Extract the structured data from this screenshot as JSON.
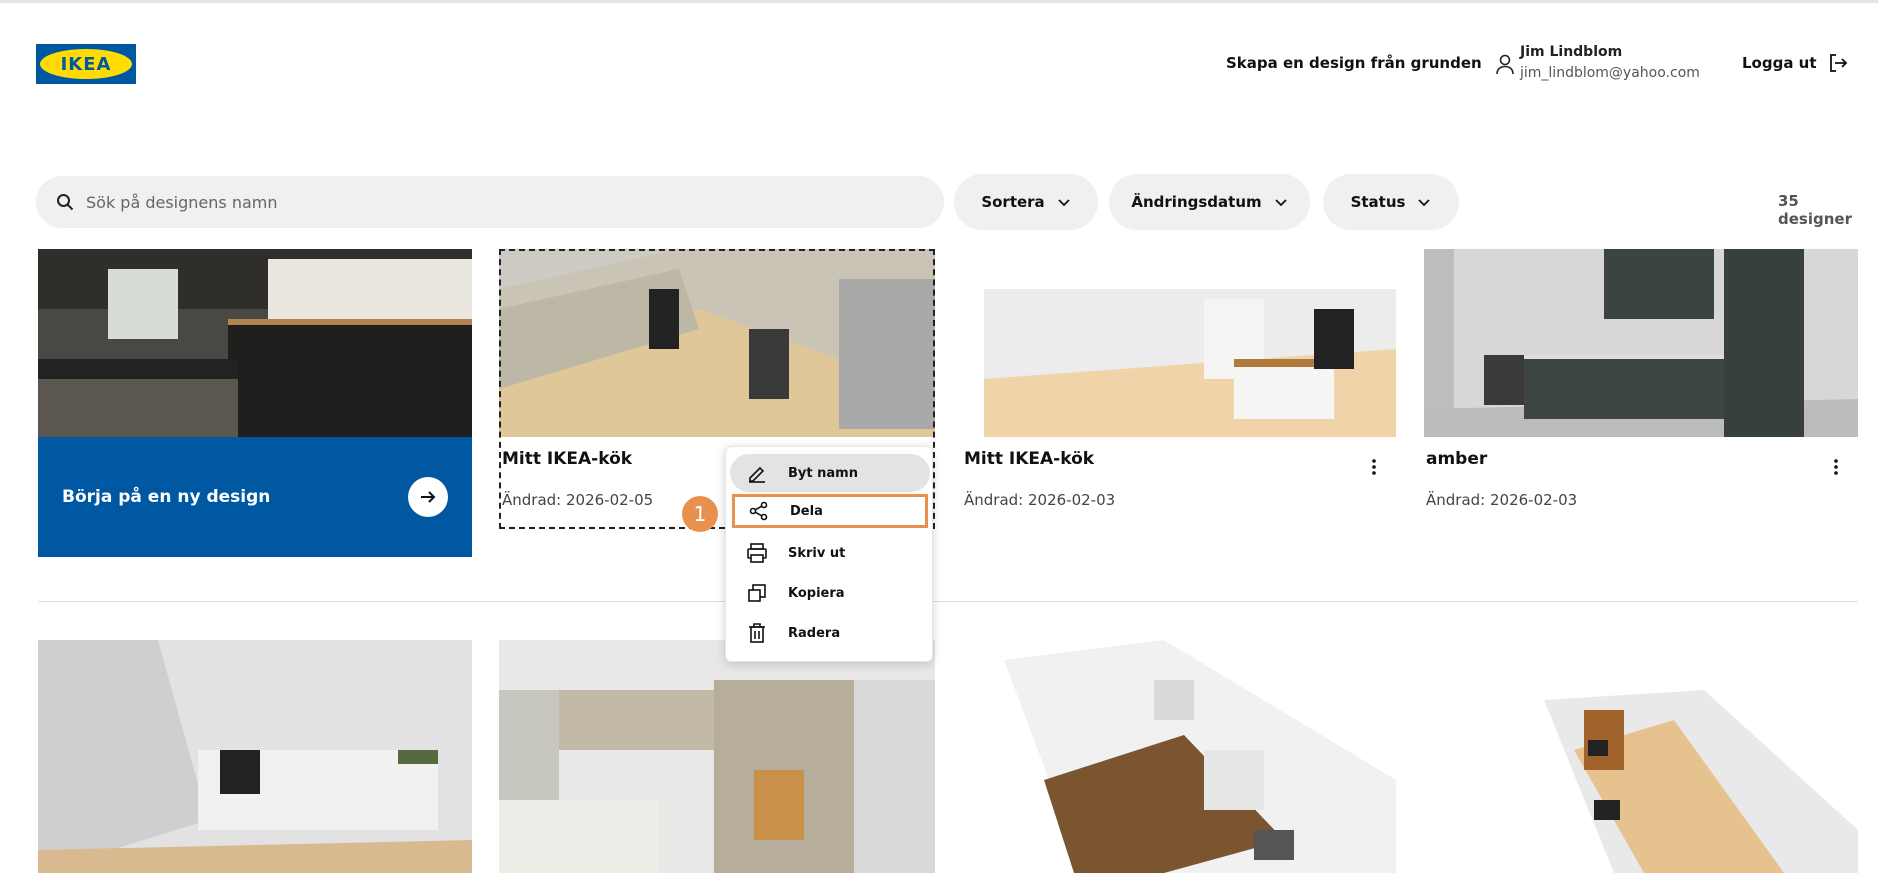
{
  "brand": {
    "logo_text": "IKEA",
    "blue": "#0058a3",
    "yellow": "#ffdb00"
  },
  "header": {
    "create_link": "Skapa en design från grunden",
    "user_name": "Jim Lindblom",
    "user_email": "jim_lindblom@yahoo.com",
    "logout_label": "Logga ut"
  },
  "toolbar": {
    "search_placeholder": "Sök på designens namn",
    "sort_label": "Sortera",
    "date_label": "Ändringsdatum",
    "status_label": "Status",
    "count": "35 designer"
  },
  "new_design": {
    "label": "Börja på en ny design"
  },
  "designs": [
    {
      "title": "Mitt IKEA-kök",
      "date": "Ändrad: 2026-02-05"
    },
    {
      "title": "Mitt IKEA-kök",
      "date": "Ändrad: 2026-02-03"
    },
    {
      "title": "amber",
      "date": "Ändrad: 2026-02-03"
    }
  ],
  "context_menu": {
    "items": [
      "Byt namn",
      "Dela",
      "Skriv ut",
      "Kopiera",
      "Radera"
    ],
    "highlight_color": "#e8914e",
    "step_badge": "1"
  }
}
